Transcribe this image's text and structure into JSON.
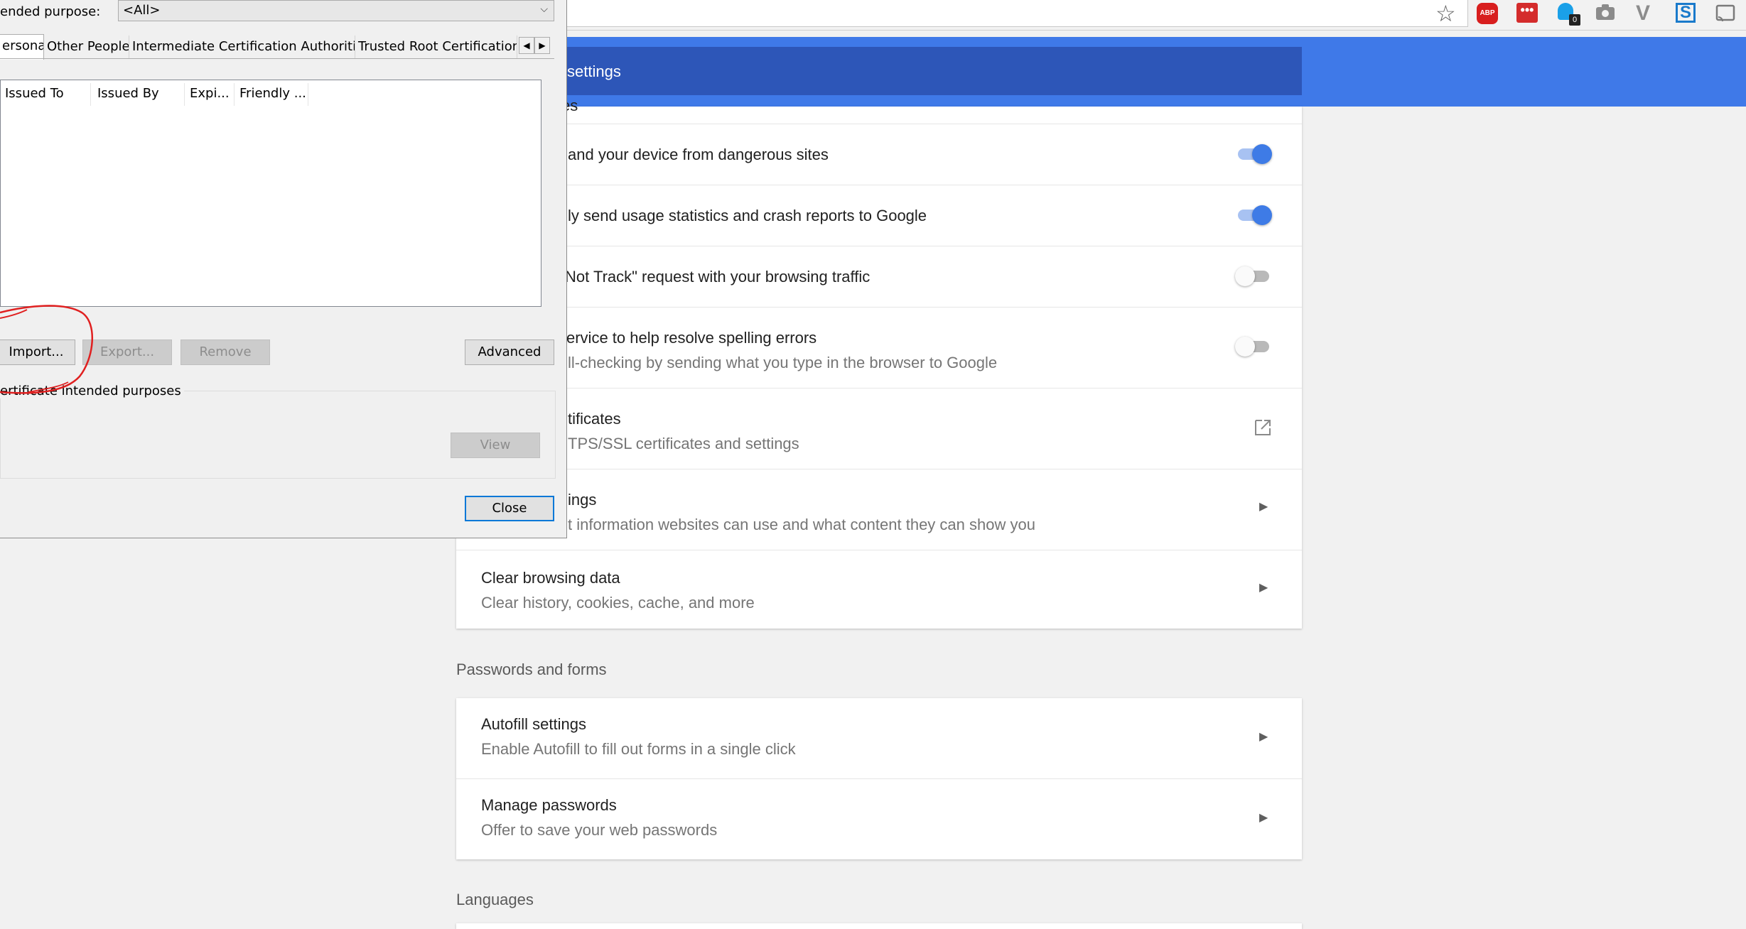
{
  "toolbar": {
    "star_glyph": "☆",
    "extensions": {
      "abp_label": "ABP",
      "dots_label": "•••",
      "ghost_badge": "0",
      "v_label": "V",
      "s_label": "S"
    }
  },
  "header": {
    "title": "settings"
  },
  "privacy_card": {
    "top_fragment": "es",
    "rows": [
      {
        "title": "and your device from dangerous sites",
        "toggle": "on"
      },
      {
        "title": "ly send usage statistics and crash reports to Google",
        "toggle": "on"
      },
      {
        "title": "Not Track\" request with your browsing traffic",
        "toggle": "off"
      },
      {
        "title": "ervice to help resolve spelling errors",
        "subtitle": "ll-checking by sending what you type in the browser to Google",
        "toggle": "off"
      },
      {
        "title": "tificates",
        "subtitle": "TPS/SSL certificates and settings"
      },
      {
        "title": "ings",
        "subtitle": "t information websites can use and what content they can show you"
      },
      {
        "title": "Clear browsing data",
        "subtitle": "Clear history, cookies, cache, and more"
      }
    ]
  },
  "passwords_section": {
    "heading": "Passwords and forms",
    "rows": [
      {
        "title": "Autofill settings",
        "subtitle": "Enable Autofill to fill out forms in a single click"
      },
      {
        "title": "Manage passwords",
        "subtitle": "Offer to save your web passwords"
      }
    ]
  },
  "languages_section": {
    "heading": "Languages"
  },
  "dialog": {
    "purpose_label": "ended purpose:",
    "purpose_value": "<All>",
    "tabs": [
      "ersonal",
      "Other People",
      "Intermediate Certification Authorities",
      "Trusted Root Certification A"
    ],
    "columns": [
      "Issued To",
      "Issued By",
      "Expi...",
      "Friendly ..."
    ],
    "buttons": {
      "import": "Import...",
      "export": "Export...",
      "remove": "Remove",
      "advanced": "Advanced",
      "view": "View",
      "close": "Close"
    },
    "purposes_label": "ertificate intended purposes"
  },
  "colors": {
    "header_blue": "#3f79e8",
    "header_inner": "#2d56b8",
    "toggle_on": "#3e7be6",
    "annotation_red": "#e02020"
  }
}
